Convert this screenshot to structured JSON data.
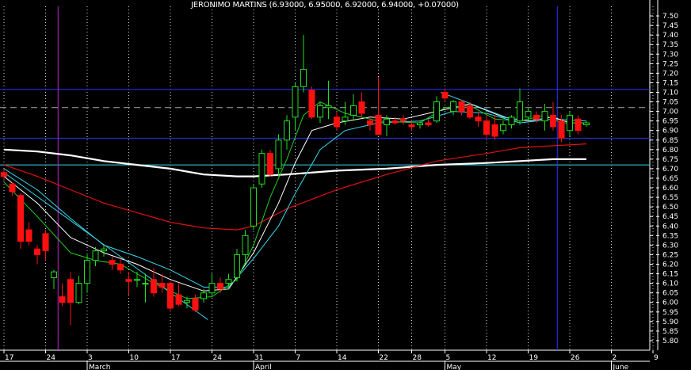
{
  "chart_data": {
    "type": "candlestick",
    "title": "JERONIMO MARTINS (6.93000, 6.95000, 6.92000, 6.94000, +0.07000)",
    "ylim": [
      5.75,
      7.55
    ],
    "y_ticks": [
      7.5,
      7.45,
      7.4,
      7.35,
      7.3,
      7.25,
      7.2,
      7.15,
      7.1,
      7.05,
      7.0,
      6.95,
      6.9,
      6.85,
      6.8,
      6.75,
      6.7,
      6.65,
      6.6,
      6.55,
      6.5,
      6.45,
      6.4,
      6.35,
      6.3,
      6.25,
      6.2,
      6.15,
      6.1,
      6.05,
      6.0,
      5.95,
      5.9,
      5.85,
      5.8
    ],
    "x_ticks": [
      {
        "bar": 0,
        "label": "17"
      },
      {
        "bar": 5,
        "label": "24"
      },
      {
        "bar": 10,
        "label": "3"
      },
      {
        "bar": 15,
        "label": "10"
      },
      {
        "bar": 20,
        "label": "17"
      },
      {
        "bar": 25,
        "label": "24"
      },
      {
        "bar": 30,
        "label": "31"
      },
      {
        "bar": 35,
        "label": "7"
      },
      {
        "bar": 40,
        "label": "14"
      },
      {
        "bar": 45,
        "label": "22"
      },
      {
        "bar": 49,
        "label": "28"
      },
      {
        "bar": 53,
        "label": "5"
      },
      {
        "bar": 58,
        "label": "12"
      },
      {
        "bar": 63,
        "label": "19"
      },
      {
        "bar": 68,
        "label": "26"
      },
      {
        "bar": 73,
        "label": "2"
      },
      {
        "bar": 78,
        "label": "9"
      }
    ],
    "months": [
      {
        "bar": 10,
        "label": "March"
      },
      {
        "bar": 30,
        "label": "April"
      },
      {
        "bar": 53,
        "label": "May"
      },
      {
        "bar": 73,
        "label": "June"
      }
    ],
    "candles": [
      [
        6.68,
        6.7,
        6.64,
        6.66
      ],
      [
        6.62,
        6.63,
        6.56,
        6.58
      ],
      [
        6.56,
        6.57,
        6.28,
        6.32
      ],
      [
        6.38,
        6.42,
        6.3,
        6.32
      ],
      [
        6.28,
        6.3,
        6.2,
        6.25
      ],
      [
        6.36,
        6.38,
        6.22,
        6.27
      ],
      [
        6.13,
        6.17,
        6.07,
        6.16
      ],
      [
        6.03,
        6.1,
        5.98,
        6.0
      ],
      [
        6.12,
        6.16,
        5.88,
        6.0
      ],
      [
        6.0,
        6.14,
        5.99,
        6.1
      ],
      [
        6.1,
        6.25,
        6.05,
        6.22
      ],
      [
        6.22,
        6.29,
        6.19,
        6.27
      ],
      [
        6.27,
        6.3,
        6.24,
        6.28
      ],
      [
        6.22,
        6.24,
        6.17,
        6.2
      ],
      [
        6.2,
        6.23,
        6.15,
        6.17
      ],
      [
        6.12,
        6.16,
        6.04,
        6.11
      ],
      [
        6.12,
        6.16,
        6.08,
        6.12
      ],
      [
        6.1,
        6.15,
        6.0,
        6.1
      ],
      [
        6.12,
        6.18,
        6.03,
        6.05
      ],
      [
        6.1,
        6.15,
        6.05,
        6.08
      ],
      [
        6.1,
        6.11,
        5.96,
        5.97
      ],
      [
        6.04,
        6.1,
        5.98,
        5.99
      ],
      [
        6.0,
        6.03,
        5.97,
        6.01
      ],
      [
        6.02,
        6.04,
        5.95,
        5.96
      ],
      [
        6.02,
        6.07,
        6.0,
        6.05
      ],
      [
        6.05,
        6.15,
        6.04,
        6.1
      ],
      [
        6.1,
        6.13,
        6.05,
        6.07
      ],
      [
        6.1,
        6.15,
        6.07,
        6.12
      ],
      [
        6.13,
        6.28,
        6.11,
        6.25
      ],
      [
        6.25,
        6.38,
        6.2,
        6.35
      ],
      [
        6.4,
        6.62,
        6.38,
        6.6
      ],
      [
        6.62,
        6.8,
        6.6,
        6.78
      ],
      [
        6.78,
        6.8,
        6.66,
        6.67
      ],
      [
        6.7,
        6.88,
        6.66,
        6.85
      ],
      [
        6.85,
        6.98,
        6.8,
        6.95
      ],
      [
        6.97,
        7.15,
        6.9,
        7.13
      ],
      [
        7.13,
        7.4,
        7.1,
        7.22
      ],
      [
        7.11,
        7.13,
        6.96,
        6.97
      ],
      [
        6.97,
        7.05,
        6.94,
        7.03
      ],
      [
        7.02,
        7.16,
        6.96,
        7.03
      ],
      [
        6.97,
        7.0,
        6.9,
        6.92
      ],
      [
        6.95,
        7.05,
        6.93,
        6.97
      ],
      [
        6.98,
        7.09,
        6.95,
        7.03
      ],
      [
        7.05,
        7.1,
        6.97,
        6.99
      ],
      [
        6.95,
        6.97,
        6.9,
        6.93
      ],
      [
        6.98,
        7.18,
        6.92,
        6.88
      ],
      [
        6.93,
        6.98,
        6.87,
        6.96
      ],
      [
        6.95,
        6.97,
        6.93,
        6.94
      ],
      [
        6.96,
        6.98,
        6.93,
        6.95
      ],
      [
        6.93,
        6.95,
        6.9,
        6.92
      ],
      [
        6.93,
        6.95,
        6.91,
        6.94
      ],
      [
        6.94,
        6.96,
        6.92,
        6.93
      ],
      [
        6.95,
        7.08,
        6.94,
        7.05
      ],
      [
        7.1,
        7.12,
        7.05,
        7.07
      ],
      [
        7.0,
        7.06,
        6.98,
        7.05
      ],
      [
        7.05,
        7.06,
        6.98,
        7.0
      ],
      [
        7.03,
        7.05,
        6.96,
        6.97
      ],
      [
        6.97,
        7.0,
        6.92,
        6.95
      ],
      [
        6.95,
        6.98,
        6.86,
        6.88
      ],
      [
        6.93,
        6.98,
        6.85,
        6.87
      ],
      [
        6.9,
        6.95,
        6.88,
        6.93
      ],
      [
        6.93,
        6.98,
        6.91,
        6.97
      ],
      [
        6.95,
        7.12,
        6.93,
        7.05
      ],
      [
        6.97,
        7.02,
        6.95,
        7.0
      ],
      [
        6.98,
        7.0,
        6.94,
        6.96
      ],
      [
        6.95,
        7.04,
        6.9,
        7.0
      ],
      [
        6.98,
        7.05,
        6.9,
        6.92
      ],
      [
        6.95,
        6.98,
        6.84,
        6.86
      ],
      [
        6.9,
        7.0,
        6.87,
        6.98
      ],
      [
        6.96,
        6.98,
        6.88,
        6.9
      ],
      [
        6.93,
        6.95,
        6.92,
        6.94
      ]
    ],
    "h_lines": [
      {
        "y": 7.115,
        "color": "#2b35ff",
        "style": "solid"
      },
      {
        "y": 7.02,
        "color": "#aaaaaa",
        "style": "dashed"
      },
      {
        "y": 6.86,
        "color": "#2b35ff",
        "style": "solid"
      },
      {
        "y": 6.72,
        "color": "#38d6e8",
        "style": "solid"
      }
    ],
    "v_lines": [
      {
        "bar": 6.5,
        "color": "#c020d0"
      },
      {
        "bar": 66.5,
        "color": "#2b35ff"
      }
    ],
    "trend_lines": [
      {
        "x1": 0,
        "y1": 6.68,
        "x2": 24.5,
        "y2": 5.91,
        "color": "#38d6e8"
      },
      {
        "x1": 52.5,
        "y1": 7.1,
        "x2": 61.5,
        "y2": 6.95,
        "color": "#38d6e8"
      }
    ],
    "ma_series": [
      {
        "color": "#ffffff",
        "width": 2.2,
        "values": [
          [
            0,
            6.8
          ],
          [
            4,
            6.79
          ],
          [
            8,
            6.77
          ],
          [
            12,
            6.74
          ],
          [
            16,
            6.72
          ],
          [
            20,
            6.7
          ],
          [
            24,
            6.67
          ],
          [
            28,
            6.66
          ],
          [
            30,
            6.66
          ],
          [
            34,
            6.67
          ],
          [
            40,
            6.69
          ],
          [
            46,
            6.7
          ],
          [
            52,
            6.72
          ],
          [
            58,
            6.73
          ],
          [
            62,
            6.74
          ],
          [
            66,
            6.75
          ],
          [
            70,
            6.75
          ]
        ]
      },
      {
        "color": "#e01010",
        "width": 1.2,
        "values": [
          [
            0,
            6.72
          ],
          [
            4,
            6.66
          ],
          [
            8,
            6.59
          ],
          [
            12,
            6.52
          ],
          [
            16,
            6.47
          ],
          [
            20,
            6.42
          ],
          [
            24,
            6.39
          ],
          [
            28,
            6.38
          ],
          [
            30,
            6.4
          ],
          [
            34,
            6.49
          ],
          [
            40,
            6.59
          ],
          [
            46,
            6.67
          ],
          [
            52,
            6.74
          ],
          [
            58,
            6.78
          ],
          [
            62,
            6.81
          ],
          [
            66,
            6.82
          ],
          [
            70,
            6.83
          ]
        ]
      },
      {
        "color": "#38d6e8",
        "width": 1,
        "values": [
          [
            0,
            6.7
          ],
          [
            4,
            6.59
          ],
          [
            8,
            6.44
          ],
          [
            12,
            6.3
          ],
          [
            16,
            6.24
          ],
          [
            20,
            6.17
          ],
          [
            24,
            6.08
          ],
          [
            27,
            6.08
          ],
          [
            30,
            6.23
          ],
          [
            33,
            6.4
          ],
          [
            35,
            6.57
          ],
          [
            38,
            6.8
          ],
          [
            41,
            6.9
          ],
          [
            45,
            6.94
          ],
          [
            50,
            6.95
          ],
          [
            54,
            7.0
          ],
          [
            58,
            6.99
          ],
          [
            62,
            6.94
          ],
          [
            66,
            6.96
          ],
          [
            70,
            6.95
          ]
        ]
      },
      {
        "color": "#ffffff",
        "width": 1,
        "values": [
          [
            0,
            6.66
          ],
          [
            4,
            6.52
          ],
          [
            8,
            6.34
          ],
          [
            12,
            6.26
          ],
          [
            16,
            6.2
          ],
          [
            20,
            6.12
          ],
          [
            24,
            6.06
          ],
          [
            27,
            6.07
          ],
          [
            30,
            6.26
          ],
          [
            33,
            6.52
          ],
          [
            35,
            6.73
          ],
          [
            37,
            6.9
          ],
          [
            40,
            6.94
          ],
          [
            44,
            6.97
          ],
          [
            48,
            6.96
          ],
          [
            52,
            7.0
          ],
          [
            56,
            7.04
          ],
          [
            60,
            6.97
          ],
          [
            63,
            6.95
          ],
          [
            66,
            6.97
          ],
          [
            68,
            6.94
          ],
          [
            70,
            6.94
          ]
        ]
      },
      {
        "color": "#22cc22",
        "width": 1,
        "values": [
          [
            0,
            6.63
          ],
          [
            4,
            6.45
          ],
          [
            8,
            6.26
          ],
          [
            11,
            6.22
          ],
          [
            14,
            6.2
          ],
          [
            18,
            6.1
          ],
          [
            22,
            6.02
          ],
          [
            25,
            6.03
          ],
          [
            28,
            6.12
          ],
          [
            30,
            6.3
          ],
          [
            32,
            6.55
          ],
          [
            34,
            6.75
          ],
          [
            36,
            6.98
          ],
          [
            38,
            7.05
          ],
          [
            41,
            6.99
          ],
          [
            45,
            6.95
          ],
          [
            50,
            6.94
          ],
          [
            53,
            7.02
          ],
          [
            56,
            7.03
          ],
          [
            59,
            6.96
          ],
          [
            62,
            6.95
          ],
          [
            65,
            6.98
          ],
          [
            67,
            6.94
          ],
          [
            70,
            6.94
          ]
        ]
      }
    ]
  }
}
